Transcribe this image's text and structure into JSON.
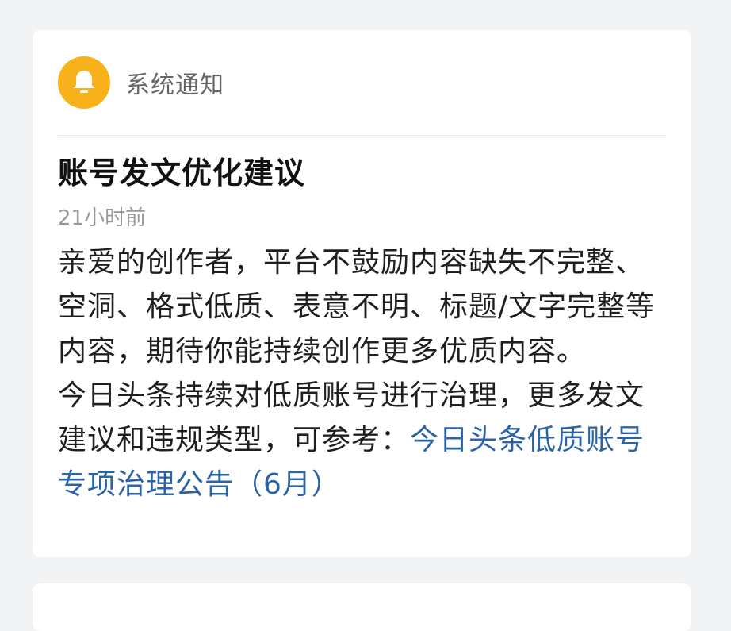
{
  "notification": {
    "category": "系统通知",
    "title": "账号发文优化建议",
    "time": "21小时前",
    "paragraph1": "亲爱的创作者，平台不鼓励内容缺失不完整、空洞、格式低质、表意不明、标题/文字完整等内容，期待你能持续创作更多优质内容。",
    "paragraph2_text": "今日头条持续对低质账号进行治理，更多发文建议和违规类型，可参考：",
    "paragraph2_link": "今日头条低质账号专项治理公告（6月）"
  },
  "icons": {
    "header_icon": "bell-icon"
  },
  "colors": {
    "background": "#f2f3f5",
    "card": "#ffffff",
    "bell_accent": "#f7b21b",
    "link": "#2a64a6"
  }
}
